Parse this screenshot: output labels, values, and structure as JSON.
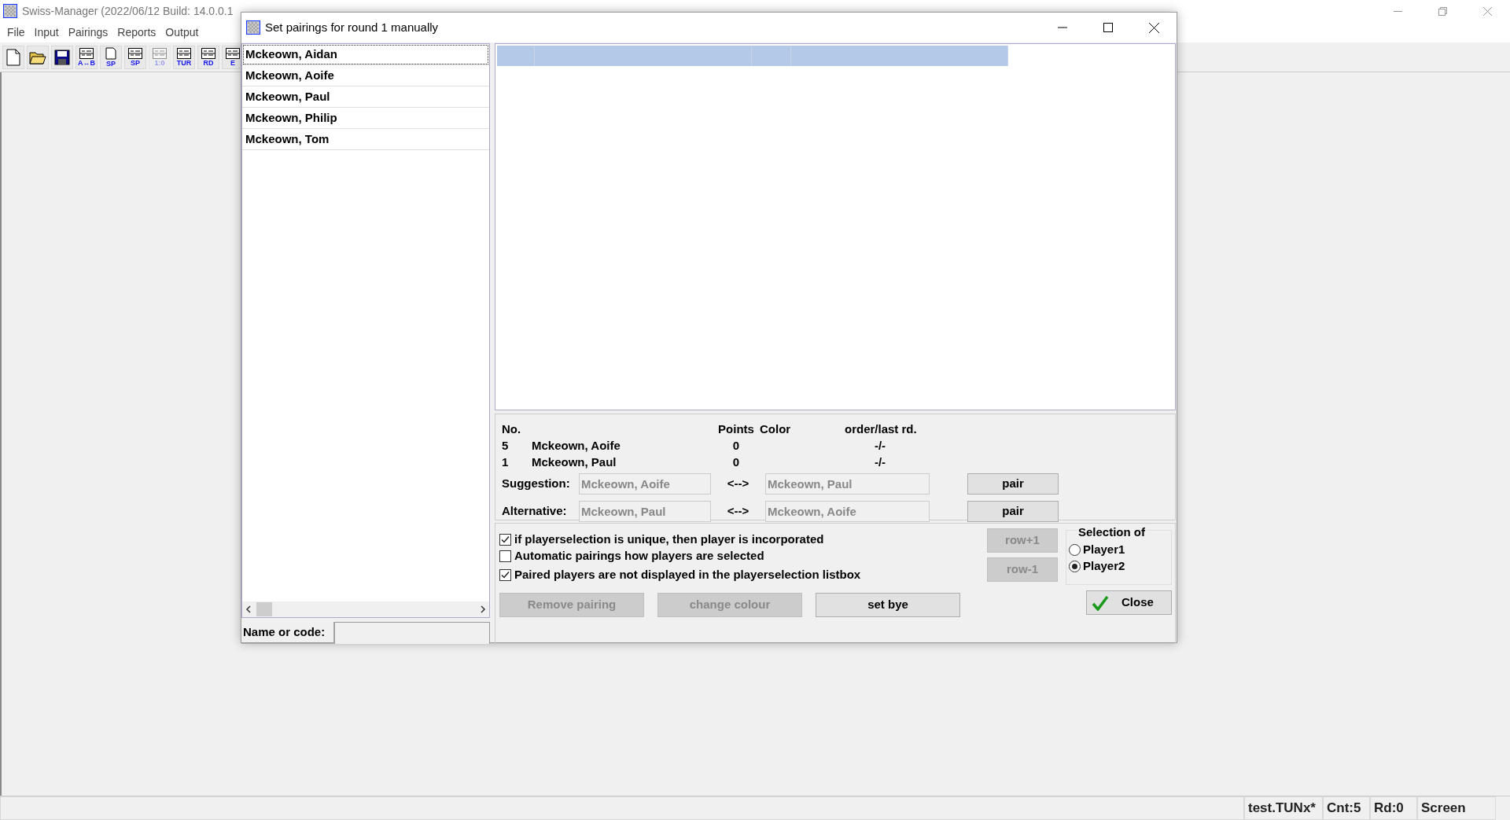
{
  "window": {
    "title": "Swiss-Manager (2022/06/12 Build: 14.0.0.1"
  },
  "menu": [
    "File",
    "Input",
    "Pairings",
    "Reports",
    "Output"
  ],
  "toolbar": [
    {
      "kind": "new",
      "disabled": false
    },
    {
      "kind": "open",
      "disabled": false
    },
    {
      "kind": "save",
      "disabled": false
    },
    {
      "kind": "table",
      "label": "A↔B",
      "disabled": false
    },
    {
      "kind": "page",
      "label": "SP",
      "disabled": false
    },
    {
      "kind": "table",
      "label": "SP",
      "disabled": false
    },
    {
      "kind": "table",
      "label": "1:0",
      "disabled": true
    },
    {
      "kind": "table",
      "label": "TUR",
      "disabled": false
    },
    {
      "kind": "table",
      "label": "RD",
      "disabled": false
    },
    {
      "kind": "table",
      "label": "E",
      "disabled": false
    }
  ],
  "dialog": {
    "title": "Set pairings for round 1 manually",
    "players": [
      {
        "name": "Mckeown, Aidan",
        "selected": true
      },
      {
        "name": "Mckeown, Aoife",
        "selected": false
      },
      {
        "name": "Mckeown, Paul",
        "selected": false
      },
      {
        "name": "Mckeown, Philip",
        "selected": false
      },
      {
        "name": "Mckeown, Tom",
        "selected": false
      }
    ],
    "info": {
      "headers": [
        "No.",
        "Points",
        "Color",
        "order/last rd."
      ],
      "rows": [
        {
          "no": "5",
          "name": "Mckeown, Aoife",
          "points": "0",
          "order": "-/-"
        },
        {
          "no": "1",
          "name": "Mckeown, Paul",
          "points": "0",
          "order": "-/-"
        }
      ]
    },
    "proposals": [
      {
        "label": "Suggestion:",
        "player1": "Mckeown, Aoife",
        "arrow": "<-->",
        "player2": "Mckeown, Paul",
        "button": "pair"
      },
      {
        "label": "Alternative:",
        "player1": "Mckeown, Paul",
        "arrow": "<-->",
        "player2": "Mckeown, Aoife",
        "button": "pair"
      }
    ],
    "options": [
      {
        "label": "if playerselection is unique, then player is incorporated",
        "checked": true
      },
      {
        "label": "Automatic pairings how players are selected",
        "checked": false
      },
      {
        "label": "Paired players are not displayed in the playerselection listbox",
        "checked": true
      }
    ],
    "row_buttons": [
      {
        "label": "row+1",
        "disabled": true
      },
      {
        "label": "row-1",
        "disabled": true
      }
    ],
    "selection": {
      "title": "Selection of",
      "options": [
        {
          "label": "Player1",
          "selected": false
        },
        {
          "label": "Player2",
          "selected": true
        }
      ]
    },
    "actions": [
      {
        "label": "Remove pairing",
        "disabled": true
      },
      {
        "label": "change colour",
        "disabled": true
      },
      {
        "label": "set bye",
        "disabled": false
      }
    ],
    "close_button": "Close",
    "search": {
      "label": "Name or code:"
    }
  },
  "status_bar": [
    "test.TUNx*",
    "Cnt:5",
    "Rd:0",
    "Screen"
  ]
}
